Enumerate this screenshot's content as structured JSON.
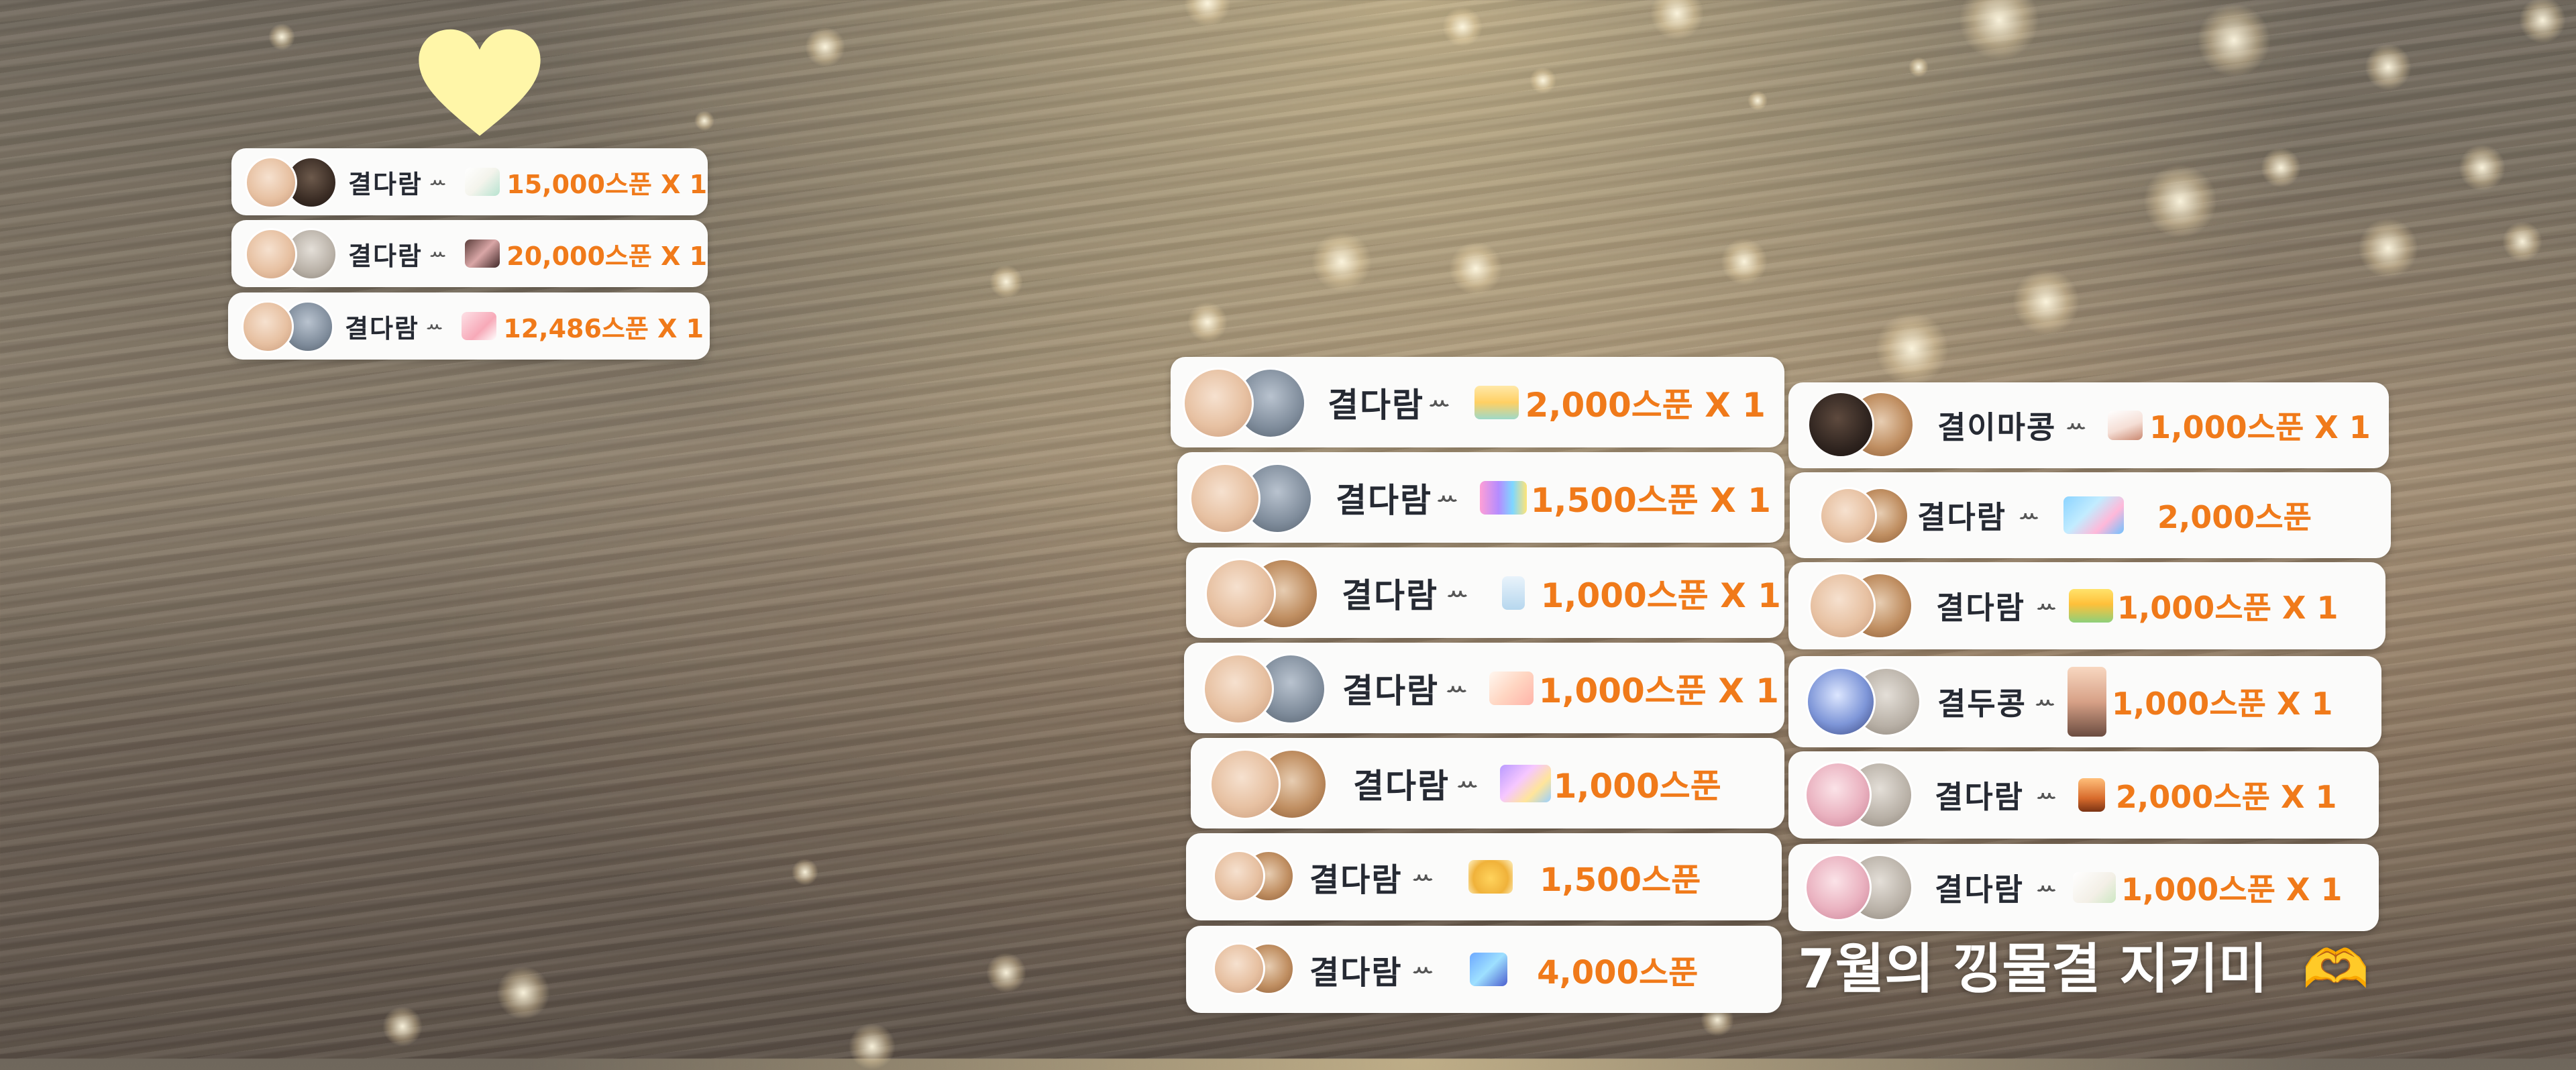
{
  "caption": {
    "text": "7월의 낑물결 지키미",
    "emoji": "🫶"
  },
  "colors": {
    "card_bg": "#fbfbfa",
    "name_text": "#262a33",
    "amount_text": "#f07a1a",
    "heart": "#fff6a8"
  },
  "top_left_cards": [
    {
      "name": "결다람",
      "badge": "ꕀ",
      "item_icon": "cake-icon",
      "amount": "15,000스푼 X 1"
    },
    {
      "name": "결다람",
      "badge": "ꕀ",
      "item_icon": "photo-icon",
      "amount": "20,000스푼 X 1"
    },
    {
      "name": "결다람",
      "badge": "ꕀ",
      "item_icon": "ribbon-icon",
      "amount": "12,486스푼 X 1"
    }
  ],
  "middle_cards": [
    {
      "name": "결다람",
      "badge": "ꕀ",
      "item_icon": "cake-icon",
      "amount": "2,000스푼 X 1"
    },
    {
      "name": "결다람",
      "badge": "ꕀ",
      "item_icon": "banner-icon",
      "amount": "1,500스푼 X 1"
    },
    {
      "name": "결다람",
      "badge": "ꕀ",
      "item_icon": "cup-icon",
      "amount": "1,000스푼 X 1"
    },
    {
      "name": "결다람",
      "badge": "ꕀ",
      "item_icon": "card-icon",
      "amount": "1,000스푼 X 1"
    },
    {
      "name": "결다람",
      "badge": "ꕀ",
      "item_icon": "flower-icon",
      "amount": "1,000스푼"
    },
    {
      "name": "결다람",
      "badge": "ꕀ",
      "item_icon": "beer-icon",
      "amount": "1,500스푼"
    },
    {
      "name": "결다람",
      "badge": "ꕀ",
      "item_icon": "board-icon",
      "amount": "4,000스푼"
    }
  ],
  "right_cards": [
    {
      "name": "결이마콩",
      "badge": "ꕀ",
      "item_icon": "cake-slice-icon",
      "amount": "1,000스푼 X 1"
    },
    {
      "name": "결다람",
      "badge": "ꕀ",
      "item_icon": "cloud-card-icon",
      "amount": "2,000스푼"
    },
    {
      "name": "결다람",
      "badge": "ꕀ",
      "item_icon": "flower-field-icon",
      "amount": "1,000스푼 X 1"
    },
    {
      "name": "결두콩",
      "badge": "ꕀ",
      "item_icon": "frame-icon",
      "amount": "1,000스푼 X 1"
    },
    {
      "name": "결다람",
      "badge": "ꕀ",
      "item_icon": "book-icon",
      "amount": "2,000스푼 X 1"
    },
    {
      "name": "결다람",
      "badge": "ꕀ",
      "item_icon": "letter-icon",
      "amount": "1,000스푼 X 1"
    }
  ]
}
